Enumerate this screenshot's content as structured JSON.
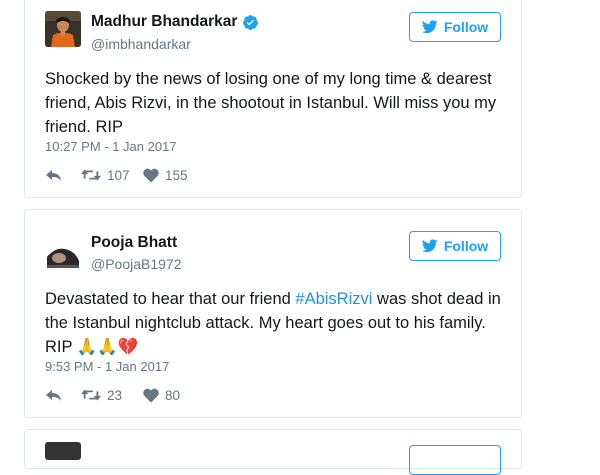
{
  "tweets": [
    {
      "name": "Madhur Bhandarkar",
      "verified": true,
      "handle": "@imbhandarkar",
      "follow_label": "Follow",
      "text": "Shocked by the news of losing one of my long time & dearest friend, Abis Rizvi, in the shootout in Istanbul. Will miss you my friend. RIP",
      "time": "10:27 PM - 1 Jan 2017",
      "retweets": "107",
      "likes": "155"
    },
    {
      "name": "Pooja Bhatt",
      "verified": false,
      "handle": "@PoojaB1972",
      "follow_label": "Follow",
      "text_before": "Devastated to hear that our friend ",
      "hashtag": "#AbisRizvi",
      "text_after": " was shot dead in the Istanbul nightclub attack. My heart goes out to his family. RIP ",
      "emoji": "🙏🙏💔",
      "time": "9:53 PM - 1 Jan 2017",
      "retweets": "23",
      "likes": "80"
    }
  ],
  "colors": {
    "accent": "#1da1f2",
    "hashtag": "#1b95e0",
    "secondary_text": "#657786",
    "border": "#e1e8ed"
  },
  "icons": [
    "verified-badge-icon",
    "twitter-bird-icon",
    "reply-icon",
    "retweet-icon",
    "heart-icon"
  ]
}
